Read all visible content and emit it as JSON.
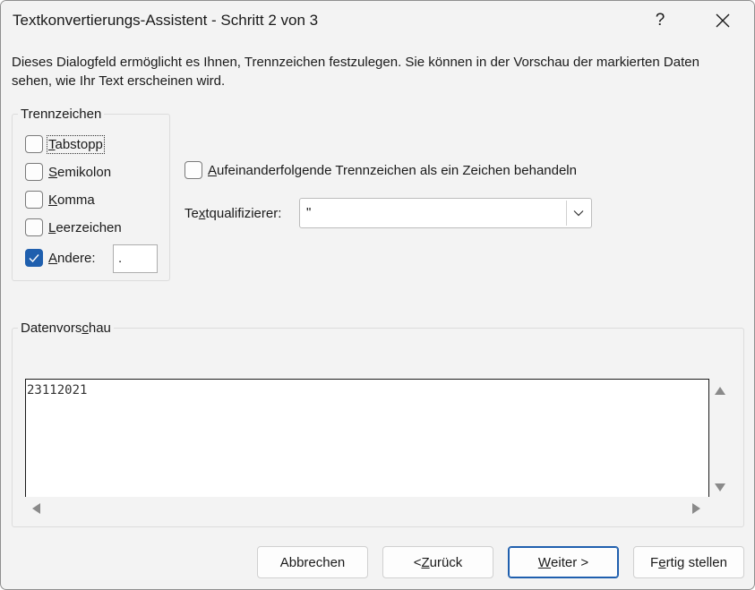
{
  "window": {
    "title": "Textkonvertierungs-Assistent - Schritt 2 von 3",
    "help_label": "?"
  },
  "description": "Dieses Dialogfeld ermöglicht es Ihnen, Trennzeichen festzulegen. Sie können in der Vorschau der markierten Daten sehen, wie Ihr Text erscheinen wird.",
  "delimiters": {
    "group_label": "Trennzeichen",
    "tab": {
      "label_pre": "",
      "label_ul": "T",
      "label_post": "abstopp",
      "checked": false
    },
    "semicolon": {
      "label_pre": "",
      "label_ul": "S",
      "label_post": "emikolon",
      "checked": false
    },
    "comma": {
      "label_pre": "",
      "label_ul": "K",
      "label_post": "omma",
      "checked": false
    },
    "space": {
      "label_pre": "",
      "label_ul": "L",
      "label_post": "eerzeichen",
      "checked": false
    },
    "other": {
      "label_pre": "",
      "label_ul": "A",
      "label_post": "ndere:",
      "checked": true,
      "value": "."
    }
  },
  "options": {
    "consecutive": {
      "label_pre": "",
      "label_ul": "A",
      "label_post": "ufeinanderfolgende Trennzeichen als ein Zeichen behandeln",
      "checked": false
    },
    "text_qualifier": {
      "label_pre": "Te",
      "label_ul": "x",
      "label_post": "tqualifizierer:",
      "value": "\""
    }
  },
  "preview": {
    "group_label_pre": "Datenvors",
    "group_label_ul": "c",
    "group_label_post": "hau",
    "rows": [
      "23112021"
    ]
  },
  "buttons": {
    "cancel": "Abbrechen",
    "back_pre": "< ",
    "back_ul": "Z",
    "back_post": "urück",
    "next_pre": "",
    "next_ul": "W",
    "next_post": "eiter >",
    "finish_pre": "F",
    "finish_ul": "e",
    "finish_post": "rtig stellen"
  },
  "colors": {
    "accent": "#1f5fae",
    "background": "#f3f3f3"
  }
}
